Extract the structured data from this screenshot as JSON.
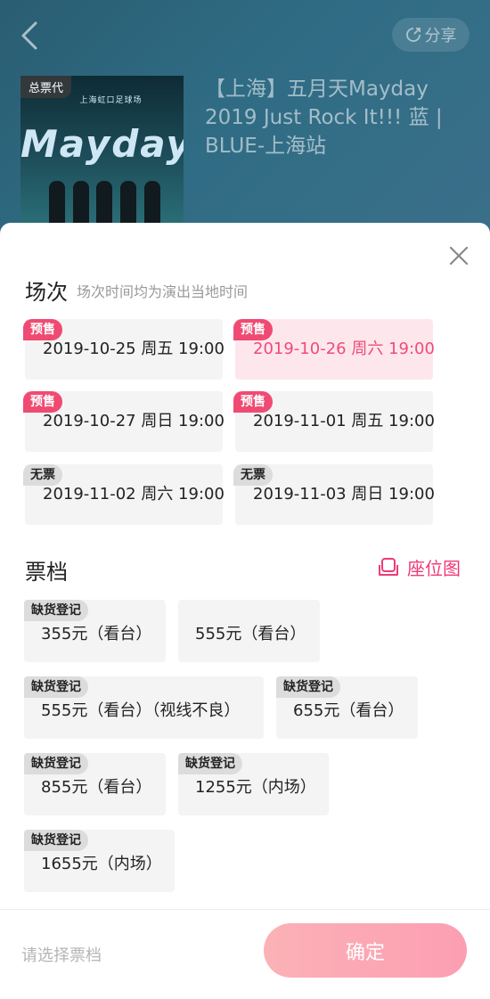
{
  "header": {
    "share_label": "分享",
    "event_title": "【上海】五月天Mayday 2019 Just Rock It!!! 蓝 | BLUE-上海站",
    "poster": {
      "agent_label": "总票代",
      "poster_subtitle": "上海虹口足球场",
      "poster_wordmark": "Mayday"
    }
  },
  "sessions": {
    "title": "场次",
    "subtitle": "场次时间均为演出当地时间",
    "items": [
      {
        "tag": "预售",
        "label": "2019-10-25 周五 19:00"
      },
      {
        "tag": "预售",
        "label": "2019-10-26 周六 19:00",
        "selected": true
      },
      {
        "tag": "预售",
        "label": "2019-10-27 周日 19:00"
      },
      {
        "tag": "预售",
        "label": "2019-11-01 周五 19:00"
      },
      {
        "tag": "无票",
        "label": "2019-11-02 周六 19:00"
      },
      {
        "tag": "无票",
        "label": "2019-11-03 周日 19:00"
      }
    ]
  },
  "tiers": {
    "title": "票档",
    "seatmap_label": "座位图",
    "items": [
      {
        "tag": "缺货登记",
        "label": "355元（看台）"
      },
      {
        "tag": "",
        "label": "555元（看台）"
      },
      {
        "tag": "缺货登记",
        "label": "555元（看台）（视线不良）"
      },
      {
        "tag": "缺货登记",
        "label": "655元（看台）"
      },
      {
        "tag": "缺货登记",
        "label": "855元（看台）"
      },
      {
        "tag": "缺货登记",
        "label": "1255元（内场）"
      },
      {
        "tag": "缺货登记",
        "label": "1655元（内场）"
      }
    ]
  },
  "footer": {
    "hint": "请选择票档",
    "confirm_label": "确定"
  },
  "colors": {
    "accent": "#ee4b7a",
    "tag_pink": "#ef4b72",
    "header_bg": "#2f6c84",
    "card_bg": "#f4f4f4"
  },
  "icons": [
    "back-arrow-icon",
    "share-icon",
    "close-icon",
    "seat-icon"
  ]
}
